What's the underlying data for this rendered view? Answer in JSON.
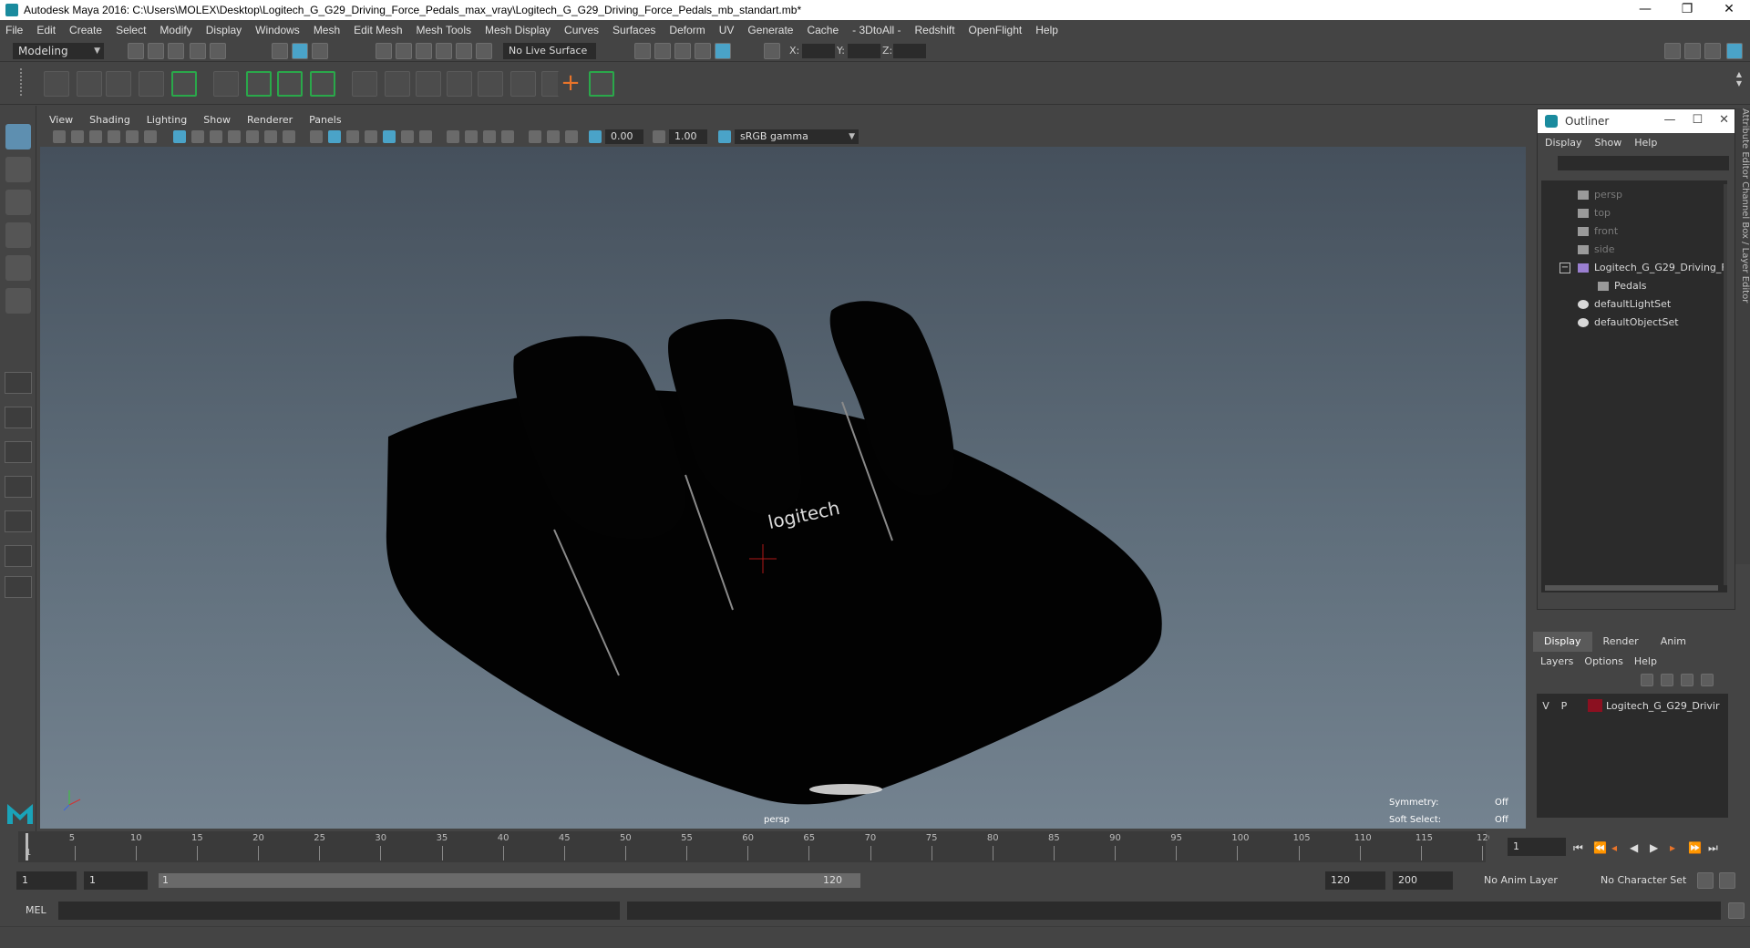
{
  "window": {
    "title": "Autodesk Maya 2016: C:\\Users\\MOLEX\\Desktop\\Logitech_G_G29_Driving_Force_Pedals_max_vray\\Logitech_G_G29_Driving_Force_Pedals_mb_standart.mb*",
    "minimize": "—",
    "restore": "❐",
    "close": "✕"
  },
  "menubar": [
    "File",
    "Edit",
    "Create",
    "Select",
    "Modify",
    "Display",
    "Windows",
    "Mesh",
    "Edit Mesh",
    "Mesh Tools",
    "Mesh Display",
    "Curves",
    "Surfaces",
    "Deform",
    "UV",
    "Generate",
    "Cache",
    "- 3DtoAll -",
    "Redshift",
    "OpenFlight",
    "Help"
  ],
  "statusline": {
    "mode": "Modeling",
    "live_surface": "No Live Surface",
    "x_label": "X:",
    "y_label": "Y:",
    "z_label": "Z:"
  },
  "panel": {
    "menu": [
      "View",
      "Shading",
      "Lighting",
      "Show",
      "Renderer",
      "Panels"
    ],
    "exposure": "0.00",
    "gamma": "1.00",
    "color_space": "sRGB gamma"
  },
  "viewport": {
    "camera": "persp",
    "symmetry_label": "Symmetry:",
    "symmetry_value": "Off",
    "soft_select_label": "Soft Select:",
    "soft_select_value": "Off",
    "logo_text": "logitech"
  },
  "outliner": {
    "title": "Outliner",
    "menu": [
      "Display",
      "Show",
      "Help"
    ],
    "items": [
      {
        "label": "persp",
        "dim": true
      },
      {
        "label": "top",
        "dim": true
      },
      {
        "label": "front",
        "dim": true
      },
      {
        "label": "side",
        "dim": true
      },
      {
        "label": "Logitech_G_G29_Driving_F",
        "dim": false
      },
      {
        "label": "Pedals",
        "dim": false
      },
      {
        "label": "defaultLightSet",
        "dim": false
      },
      {
        "label": "defaultObjectSet",
        "dim": false
      }
    ]
  },
  "layers": {
    "tabs": [
      "Display",
      "Render",
      "Anim"
    ],
    "menu": [
      "Layers",
      "Options",
      "Help"
    ],
    "row": {
      "v": "V",
      "p": "P",
      "name": "Logitech_G_G29_Drivir",
      "color": "#8b1020"
    }
  },
  "timeline": {
    "ticks": [
      "5",
      "10",
      "15",
      "20",
      "25",
      "30",
      "35",
      "40",
      "45",
      "50",
      "55",
      "60",
      "65",
      "70",
      "75",
      "80",
      "85",
      "90",
      "95",
      "100",
      "105",
      "110",
      "115",
      "120"
    ],
    "first_label": "1",
    "current_frame": "1"
  },
  "range": {
    "start": "1",
    "playback_start": "1",
    "slider_start": "1",
    "slider_end": "120",
    "playback_end": "120",
    "end": "200",
    "anim_layer": "No Anim Layer",
    "character_set": "No Character Set"
  },
  "cmdline": {
    "label": "MEL"
  },
  "sidetabs": "Attribute Editor  Channel Box / Layer Editor"
}
